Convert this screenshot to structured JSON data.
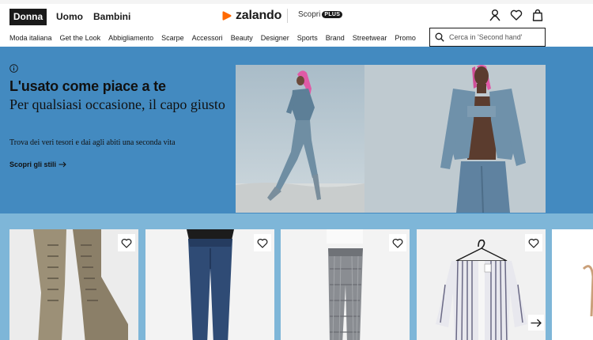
{
  "header": {
    "genders": [
      {
        "label": "Donna",
        "active": true
      },
      {
        "label": "Uomo",
        "active": false
      },
      {
        "label": "Bambini",
        "active": false
      }
    ],
    "logo_text": "zalando",
    "brand_color": "#ff6900",
    "scopri_label": "Scopri",
    "plus_badge": "PLUS",
    "icons": [
      "user-icon",
      "heart-icon",
      "bag-icon"
    ]
  },
  "categories": [
    "Moda italiana",
    "Get the Look",
    "Abbigliamento",
    "Scarpe",
    "Accessori",
    "Beauty",
    "Designer",
    "Sports",
    "Brand",
    "Streetwear",
    "Promo"
  ],
  "search": {
    "placeholder": "Cerca in 'Second hand'",
    "value": ""
  },
  "hero": {
    "title": "L'usato come piace a te",
    "subtitle": "Per qualsiasi occasione, il capo giusto",
    "description": "Trova dei veri tesori e dai agli abiti una seconda vita",
    "link_label": "Scopri gli stili",
    "background_color": "#438ac0"
  },
  "products": {
    "band_color": "#7eb6d8",
    "items": [
      {
        "icon": "knee-high-boots-image"
      },
      {
        "icon": "skinny-jeans-image"
      },
      {
        "icon": "checked-trousers-image"
      },
      {
        "icon": "striped-shirt-image"
      },
      {
        "icon": "partial-product-image"
      }
    ]
  }
}
